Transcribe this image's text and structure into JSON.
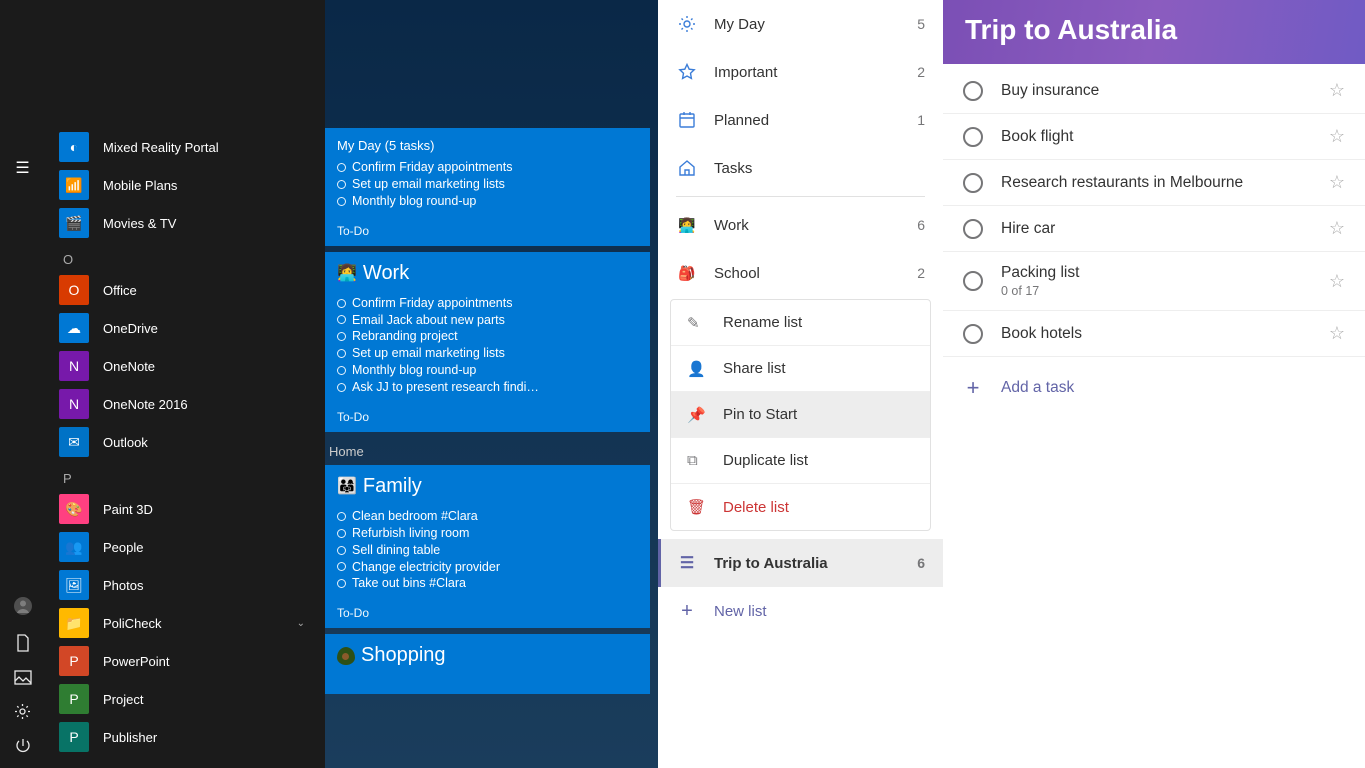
{
  "start_sidebar_icons": [
    "user",
    "document",
    "picture",
    "settings",
    "power"
  ],
  "app_list": [
    {
      "label": "Mixed Reality Portal",
      "bg": "#0078d4",
      "glyph": "◐"
    },
    {
      "label": "Mobile Plans",
      "bg": "#0078d4",
      "glyph": "📶"
    },
    {
      "label": "Movies & TV",
      "bg": "#0078d4",
      "glyph": "🎬"
    },
    {
      "letter": "O"
    },
    {
      "label": "Office",
      "bg": "#d83b01",
      "glyph": "O"
    },
    {
      "label": "OneDrive",
      "bg": "#0078d4",
      "glyph": "☁"
    },
    {
      "label": "OneNote",
      "bg": "#7719aa",
      "glyph": "N"
    },
    {
      "label": "OneNote 2016",
      "bg": "#7719aa",
      "glyph": "N"
    },
    {
      "label": "Outlook",
      "bg": "#0072c6",
      "glyph": "✉"
    },
    {
      "letter": "P"
    },
    {
      "label": "Paint 3D",
      "bg": "#ff4081",
      "glyph": "🎨"
    },
    {
      "label": "People",
      "bg": "#0078d4",
      "glyph": "👥"
    },
    {
      "label": "Photos",
      "bg": "#0078d4",
      "glyph": "🖼"
    },
    {
      "label": "PoliCheck",
      "bg": "#ffb900",
      "glyph": "📁",
      "expand": true
    },
    {
      "label": "PowerPoint",
      "bg": "#d24726",
      "glyph": "P"
    },
    {
      "label": "Project",
      "bg": "#2f7d32",
      "glyph": "P"
    },
    {
      "label": "Publisher",
      "bg": "#087366",
      "glyph": "P"
    }
  ],
  "tiles": [
    {
      "header": "My Day (5 tasks)",
      "tasks": [
        "Confirm Friday appointments",
        "Set up email marketing lists",
        "Monthly blog round-up"
      ],
      "footer": "To-Do"
    },
    {
      "title_emoji": "👩‍💻",
      "title": "Work",
      "tasks": [
        "Confirm Friday appointments",
        "Email Jack about new parts",
        "Rebranding project",
        "Set up email marketing lists",
        "Monthly blog round-up",
        "Ask JJ to present research findi…"
      ],
      "footer": "To-Do"
    },
    {
      "group_label": "Home"
    },
    {
      "title_emoji": "👨‍👩‍👧",
      "title": "Family",
      "tasks": [
        "Clean bedroom #Clara",
        "Refurbish living room",
        "Sell dining table",
        "Change electricity provider",
        "Take out bins #Clara"
      ],
      "footer": "To-Do"
    },
    {
      "title_emoji": "avocado",
      "title": "Shopping",
      "tasks": [],
      "footer": ""
    }
  ],
  "todo_nav": [
    {
      "icon": "sun",
      "label": "My Day",
      "count": 5,
      "color": "#3b7dd8"
    },
    {
      "icon": "star",
      "label": "Important",
      "count": 2,
      "color": "#3b7dd8"
    },
    {
      "icon": "calendar",
      "label": "Planned",
      "count": 1,
      "color": "#3b7dd8"
    },
    {
      "icon": "home",
      "label": "Tasks",
      "count": "",
      "color": "#3b7dd8"
    }
  ],
  "todo_lists": [
    {
      "emoji": "👩‍💻",
      "label": "Work",
      "count": 6
    },
    {
      "emoji": "🎒",
      "label": "School",
      "count": 2
    }
  ],
  "context_menu": [
    {
      "icon": "✎",
      "label": "Rename list"
    },
    {
      "icon": "👤",
      "label": "Share list"
    },
    {
      "icon": "📌",
      "label": "Pin to Start",
      "hover": true
    },
    {
      "icon": "⧉",
      "label": "Duplicate list"
    },
    {
      "icon": "🗑",
      "label": "Delete list",
      "danger": true
    }
  ],
  "selected_list": {
    "icon": "☰",
    "label": "Trip to Australia",
    "count": 6
  },
  "new_list_label": "New list",
  "task_header": "Trip to Australia",
  "tasks": [
    {
      "title": "Buy insurance"
    },
    {
      "title": "Book flight"
    },
    {
      "title": "Research restaurants in Melbourne"
    },
    {
      "title": "Hire car"
    },
    {
      "title": "Packing list",
      "sub": "0 of 17"
    },
    {
      "title": "Book hotels"
    }
  ],
  "add_task_label": "Add a task"
}
